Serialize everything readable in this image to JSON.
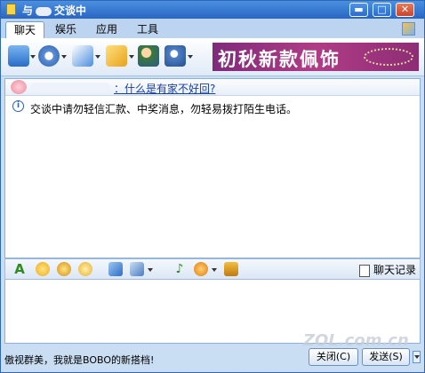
{
  "window": {
    "title_prefix": "与",
    "title_suffix": "交谈中",
    "controls": {
      "minimize": "▬",
      "maximize": "□",
      "close": "✕"
    }
  },
  "tabs": [
    {
      "label": "聊天",
      "active": true
    },
    {
      "label": "娱乐",
      "active": false
    },
    {
      "label": "应用",
      "active": false
    },
    {
      "label": "工具",
      "active": false
    }
  ],
  "ad": {
    "text": "初秋新款佩饰"
  },
  "chat": {
    "signature": "：什么是有家不好回?",
    "notice": "交谈中请勿轻信汇款、中奖消息，勿轻易拨打陌生电话。",
    "info_icon": "i"
  },
  "input_toolbar": {
    "font_glyph": "A",
    "history_label": "聊天记录"
  },
  "footer": {
    "promo": "傲视群美，我就是BOBO的新搭档!",
    "close_label": "关闭(C)",
    "send_label": "发送(S)"
  },
  "watermark": "ZOL.com.cn",
  "colors": {
    "title_bar": "#2a66c4",
    "window_bg": "#c9ddf3",
    "link": "#1a3f9c",
    "ad_bg": "#b03c86"
  }
}
